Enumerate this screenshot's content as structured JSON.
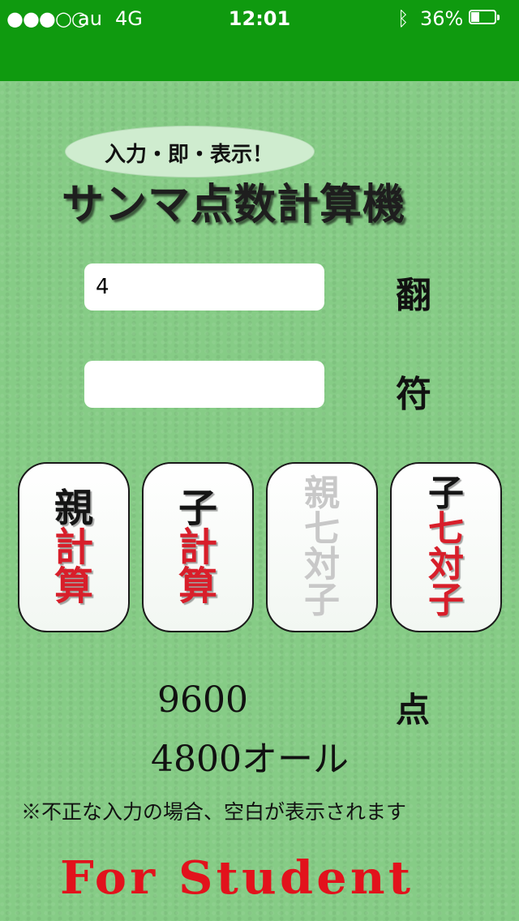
{
  "status_bar": {
    "signal": "●●●○○",
    "carrier": "au",
    "network": "4G",
    "time": "12:01",
    "bluetooth_icon": "ᛒ",
    "battery_pct": "36%",
    "battery_level": 0.36
  },
  "title": {
    "subtitle": "入力・即・表示！",
    "main": "サンマ点数計算機"
  },
  "inputs": {
    "han_value": "4",
    "han_unit": "翻",
    "fu_value": "",
    "fu_unit": "符"
  },
  "buttons": [
    {
      "line1": "親",
      "line2": "計",
      "line3": "算",
      "line4": ""
    },
    {
      "line1": "子",
      "line2": "計",
      "line3": "算",
      "line4": ""
    },
    {
      "line1": "親",
      "line2": "七",
      "line3": "対",
      "line4": "子"
    },
    {
      "line1": "子",
      "line2": "七",
      "line3": "対",
      "line4": "子"
    }
  ],
  "result": {
    "points": "9600",
    "unit": "点",
    "detail": "4800オール"
  },
  "note": "※不正な入力の場合、空白が表示されます",
  "footer": "For Student",
  "colors": {
    "status_bar": "#0f9a0f",
    "background": "#86cc86",
    "accent_red": "#d81e2a",
    "disabled_gray": "#c8c8c8"
  }
}
